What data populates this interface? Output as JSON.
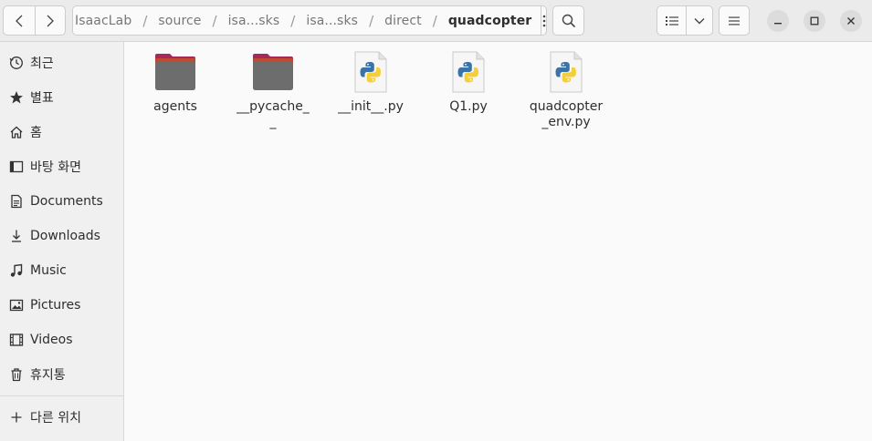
{
  "header": {
    "breadcrumbs": [
      "IsaacLab",
      "source",
      "isa...sks",
      "isa...sks",
      "direct"
    ],
    "current_folder": "quadcopter",
    "path_separator": "/",
    "icons": {
      "back": "chevron-left-icon",
      "forward": "chevron-right-icon",
      "path_menu": "vertical-dots-icon",
      "search": "search-icon",
      "view_list": "list-view-icon",
      "view_options": "chevron-down-icon",
      "main_menu": "hamburger-menu-icon",
      "minimize": "minimize-icon",
      "maximize": "maximize-icon",
      "close": "close-icon"
    }
  },
  "sidebar": {
    "items": [
      {
        "label": "최근",
        "icon": "clock-icon"
      },
      {
        "label": "별표",
        "icon": "star-icon"
      },
      {
        "label": "홈",
        "icon": "home-icon"
      },
      {
        "label": "바탕 화면",
        "icon": "desktop-icon"
      },
      {
        "label": "Documents",
        "icon": "document-icon"
      },
      {
        "label": "Downloads",
        "icon": "download-icon"
      },
      {
        "label": "Music",
        "icon": "music-note-icon"
      },
      {
        "label": "Pictures",
        "icon": "picture-icon"
      },
      {
        "label": "Videos",
        "icon": "film-icon"
      },
      {
        "label": "휴지통",
        "icon": "trash-icon"
      }
    ],
    "other_locations": {
      "label": "다른 위치",
      "icon": "plus-icon"
    }
  },
  "files": [
    {
      "name": "agents",
      "type": "folder"
    },
    {
      "name": "__pycache__",
      "type": "folder"
    },
    {
      "name": "__init__.py",
      "type": "python"
    },
    {
      "name": "Q1.py",
      "type": "python"
    },
    {
      "name": "quadcopter_env.py",
      "type": "python"
    }
  ],
  "colors": {
    "folder_top": "#a6295a",
    "folder_body": "#6d6d6d",
    "python_blue": "#3b73a8",
    "python_yellow": "#f5cf3a"
  }
}
